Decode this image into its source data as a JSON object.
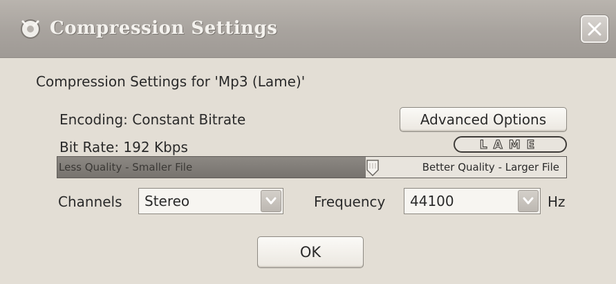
{
  "window": {
    "title": "Compression Settings",
    "subtitle": "Compression Settings for 'Mp3 (Lame)'"
  },
  "encoding": {
    "label": "Encoding: Constant Bitrate",
    "advanced_button": "Advanced Options"
  },
  "bitrate": {
    "label": "Bit Rate: 192 Kbps",
    "logo": "LAME"
  },
  "quality_slider": {
    "left_label": "Less Quality - Smaller File",
    "right_label": "Better Quality - Larger File",
    "value": 0.62
  },
  "channels": {
    "label": "Channels",
    "value": "Stereo"
  },
  "frequency": {
    "label": "Frequency",
    "value": "44100",
    "unit": "Hz"
  },
  "footer": {
    "ok_label": "OK"
  },
  "icons": {
    "title": "app-icon",
    "close": "close-icon",
    "dropdown": "chevron-down-icon",
    "slider_thumb": "slider-thumb-icon"
  }
}
